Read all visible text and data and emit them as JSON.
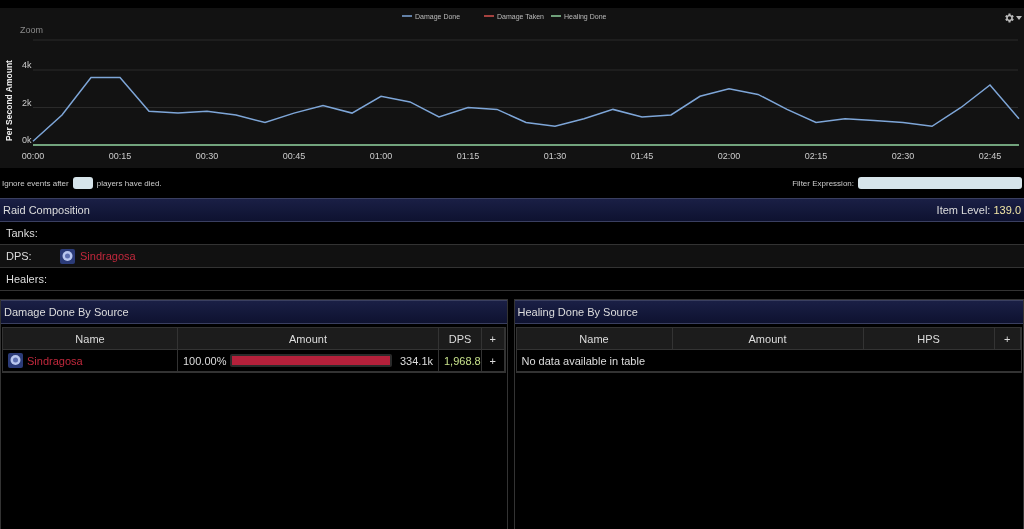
{
  "chart": {
    "zoom_label": "Zoom",
    "chart_data": {
      "type": "line",
      "ylabel": "Per Second Amount",
      "x": [
        0,
        5,
        10,
        15,
        20,
        25,
        30,
        35,
        40,
        45,
        50,
        55,
        60,
        65,
        70,
        75,
        80,
        85,
        90,
        95,
        100,
        105,
        110,
        115,
        120,
        125,
        130,
        135,
        140,
        145,
        150,
        155,
        160,
        165,
        170
      ],
      "series": [
        {
          "name": "Damage Done",
          "color": "#7ea6d8",
          "values": [
            0.2,
            1.6,
            3.6,
            3.6,
            1.8,
            1.7,
            1.8,
            1.6,
            1.2,
            1.7,
            2.1,
            1.7,
            2.6,
            2.3,
            1.5,
            2.0,
            1.9,
            1.2,
            1.0,
            1.4,
            1.9,
            1.5,
            1.6,
            2.6,
            3.0,
            2.7,
            1.9,
            1.2,
            1.4,
            1.3,
            1.2,
            1.0,
            2.0,
            3.2,
            1.4
          ]
        },
        {
          "name": "Damage Taken",
          "color": "#d9534f",
          "values": [
            null,
            null,
            null,
            null,
            null,
            null,
            null,
            null,
            null,
            null,
            null,
            null,
            null,
            null,
            null,
            null,
            null,
            null,
            null,
            null,
            null,
            null,
            null,
            null,
            null,
            null,
            null,
            null,
            null,
            null,
            null,
            null,
            null,
            null,
            null
          ]
        },
        {
          "name": "Healing Done",
          "color": "#8fd19e",
          "values": [
            0,
            0,
            0,
            0,
            0,
            0,
            0,
            0,
            0,
            0,
            0,
            0,
            0,
            0,
            0,
            0,
            0,
            0,
            0,
            0,
            0,
            0,
            0,
            0,
            0,
            0,
            0,
            0,
            0,
            0,
            0,
            0,
            0,
            0,
            0
          ]
        }
      ],
      "legend": true,
      "ylim": [
        0,
        5.6
      ],
      "xlim": [
        0,
        170
      ],
      "yticks": [
        {
          "value": 0,
          "label": "0k"
        },
        {
          "value": 2,
          "label": "2k"
        },
        {
          "value": 4,
          "label": "4k"
        }
      ],
      "xticks": [
        {
          "value": 0,
          "label": "00:00"
        },
        {
          "value": 15,
          "label": "00:15"
        },
        {
          "value": 30,
          "label": "00:30"
        },
        {
          "value": 45,
          "label": "00:45"
        },
        {
          "value": 60,
          "label": "01:00"
        },
        {
          "value": 75,
          "label": "01:15"
        },
        {
          "value": 90,
          "label": "01:30"
        },
        {
          "value": 105,
          "label": "01:45"
        },
        {
          "value": 120,
          "label": "02:00"
        },
        {
          "value": 135,
          "label": "02:15"
        },
        {
          "value": 150,
          "label": "02:30"
        },
        {
          "value": 165,
          "label": "02:45"
        }
      ]
    }
  },
  "filters": {
    "ignore_prefix": "Ignore events after",
    "ignore_suffix": "players have died.",
    "filter_label": "Filter Expression:"
  },
  "raid": {
    "title": "Raid Composition",
    "item_level_label": "Item Level:",
    "item_level_value": "139.0",
    "roles": [
      {
        "label": "Tanks:"
      },
      {
        "label": "DPS:",
        "members": [
          {
            "name": "Sindragosa"
          }
        ]
      },
      {
        "label": "Healers:"
      }
    ]
  },
  "damage_table": {
    "title": "Damage Done By Source",
    "columns": [
      "Name",
      "Amount",
      "DPS",
      "+"
    ],
    "rows": [
      {
        "name": "Sindragosa",
        "percent": "100.00%",
        "level": 1,
        "amount": "334.1k",
        "dps": "1,968.8",
        "action": "+"
      }
    ]
  },
  "healing_table": {
    "title": "Healing Done By Source",
    "columns": [
      "Name",
      "Amount",
      "HPS",
      "+"
    ],
    "empty_message": "No data available in table"
  }
}
